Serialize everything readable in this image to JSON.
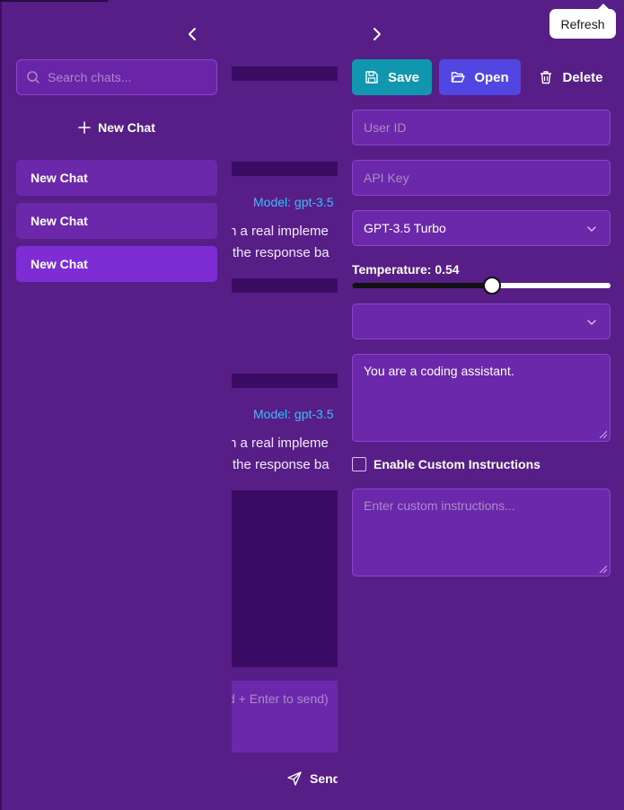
{
  "tooltip": {
    "text": "Refresh"
  },
  "sidebar": {
    "search_placeholder": "Search chats...",
    "new_chat_label": "New Chat",
    "chats": [
      {
        "label": "New Chat",
        "active": false
      },
      {
        "label": "New Chat",
        "active": false
      },
      {
        "label": "New Chat",
        "active": true
      }
    ]
  },
  "chat": {
    "messages": [
      {
        "model": "Model: gpt-3.5",
        "lines": [
          "n a real impleme",
          "the response ba"
        ]
      },
      {
        "model": "Model: gpt-3.5",
        "lines": [
          "n a real impleme",
          "the response ba"
        ]
      }
    ],
    "input_placeholder": "d + Enter to send)",
    "send_label": "Send"
  },
  "settings": {
    "save_label": "Save",
    "open_label": "Open",
    "delete_label": "Delete",
    "user_id_placeholder": "User ID",
    "api_key_placeholder": "API Key",
    "model_selected": "GPT-3.5 Turbo",
    "temperature_label": "Temperature: 0.54",
    "temperature_value": 0.54,
    "secondary_select_value": "",
    "system_prompt": "You are a coding assistant.",
    "custom_instructions_label": "Enable Custom Instructions",
    "custom_instructions_enabled": false,
    "custom_instructions_placeholder": "Enter custom instructions..."
  },
  "colors": {
    "background": "#561e86",
    "panel": "#6c28ab",
    "active_chat": "#7e2cd4",
    "save": "#1196b0",
    "open": "#5146e2",
    "model_label": "#34c0ff"
  }
}
